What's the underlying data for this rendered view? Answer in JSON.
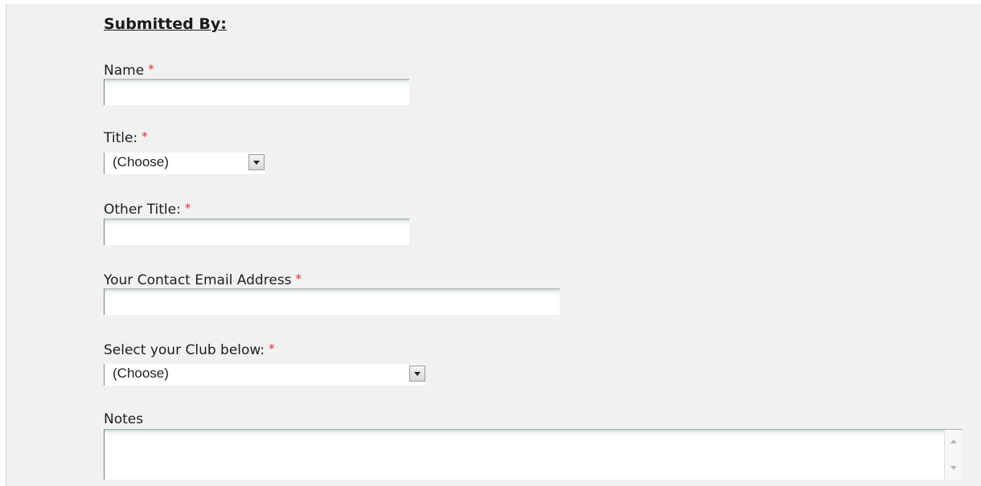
{
  "form": {
    "heading": "Submitted By:",
    "required_mark": "*",
    "name": {
      "label": "Name",
      "value": ""
    },
    "title": {
      "label": "Title:",
      "selected": "(Choose)"
    },
    "other_title": {
      "label": "Other Title:",
      "value": ""
    },
    "email": {
      "label": "Your Contact Email Address",
      "value": ""
    },
    "club": {
      "label": "Select your Club below:",
      "selected": "(Choose)"
    },
    "notes": {
      "label": "Notes",
      "value": ""
    }
  },
  "colors": {
    "required": "#d83030",
    "panel": "#f1f1f1"
  },
  "icons": {
    "dropdown": "chevron-down-icon",
    "scroll_up": "scroll-up-icon",
    "scroll_down": "scroll-down-icon"
  }
}
